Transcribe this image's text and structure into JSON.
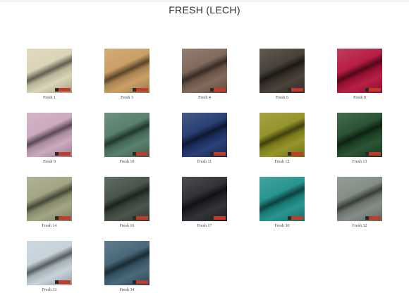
{
  "page": {
    "title": "FRESH (LECH)"
  },
  "swatches": [
    {
      "label": "Fresh 1",
      "color": "#d9d2b4"
    },
    {
      "label": "Fresh 3",
      "color": "#c89a5e"
    },
    {
      "label": "Fresh 4",
      "color": "#7a6253"
    },
    {
      "label": "Fresh 6",
      "color": "#3e372f"
    },
    {
      "label": "Fresh 8",
      "color": "#b3123a"
    },
    {
      "label": "Fresh 9",
      "color": "#c9a5bd"
    },
    {
      "label": "Fresh 10",
      "color": "#4f7a64"
    },
    {
      "label": "Fresh 11",
      "color": "#1e356c"
    },
    {
      "label": "Fresh 12",
      "color": "#8f8f1f"
    },
    {
      "label": "Fresh 13",
      "color": "#1f4a28"
    },
    {
      "label": "Fresh 14",
      "color": "#9ea17e"
    },
    {
      "label": "Fresh 16",
      "color": "#3f4c40"
    },
    {
      "label": "Fresh 17",
      "color": "#26272c"
    },
    {
      "label": "Fresh 30",
      "color": "#1c8f8a"
    },
    {
      "label": "Fresh 32",
      "color": "#7d8780"
    },
    {
      "label": "Fresh 33",
      "color": "#c3d1d8"
    },
    {
      "label": "Fresh 34",
      "color": "#3e6072"
    }
  ]
}
